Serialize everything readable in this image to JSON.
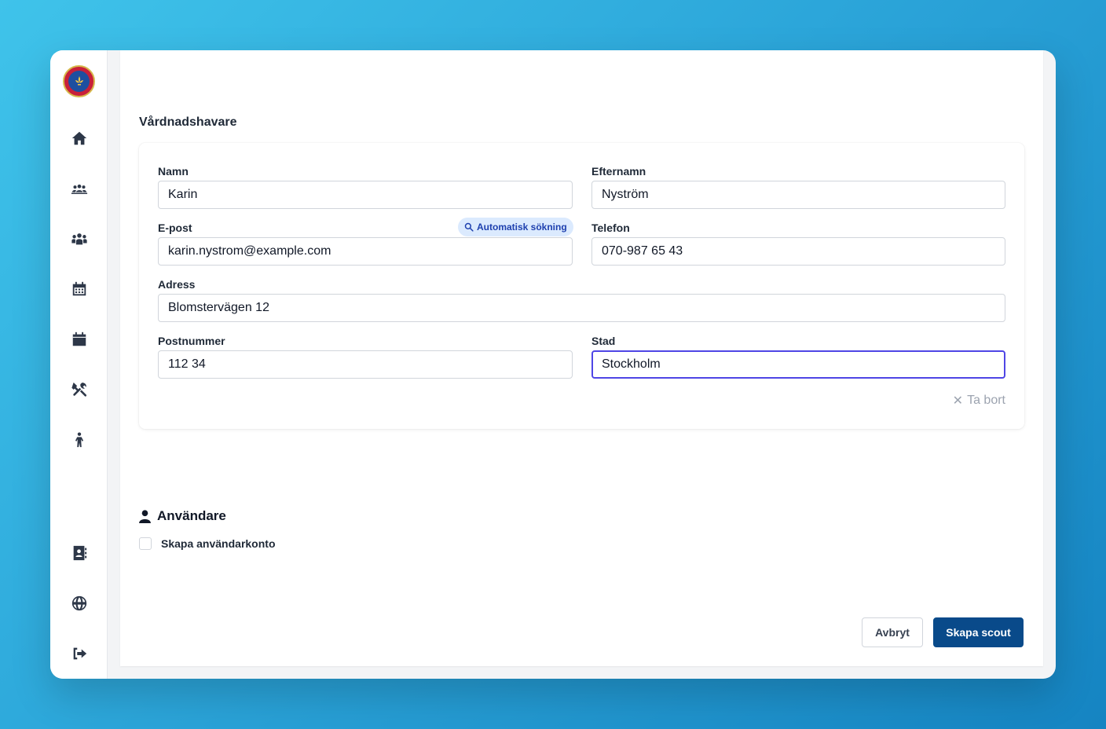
{
  "sidebar": {
    "logo": "scout-logo",
    "items": [
      {
        "icon": "home-icon"
      },
      {
        "icon": "group-icon"
      },
      {
        "icon": "users-icon"
      },
      {
        "icon": "calendar-days-icon"
      },
      {
        "icon": "calendar-icon"
      },
      {
        "icon": "tools-icon"
      },
      {
        "icon": "child-icon"
      }
    ],
    "bottom_items": [
      {
        "icon": "address-book-icon"
      },
      {
        "icon": "globe-icon"
      },
      {
        "icon": "sign-out-icon"
      }
    ]
  },
  "guardian": {
    "section_title": "Vårdnadshavare",
    "first_name_label": "Namn",
    "first_name_value": "Karin",
    "last_name_label": "Efternamn",
    "last_name_value": "Nyström",
    "email_label": "E-post",
    "email_value": "karin.nystrom@example.com",
    "auto_search_label": "Automatisk sökning",
    "phone_label": "Telefon",
    "phone_value": "070-987 65 43",
    "address_label": "Adress",
    "address_value": "Blomstervägen 12",
    "zip_label": "Postnummer",
    "zip_value": "112 34",
    "city_label": "Stad",
    "city_value": "Stockholm",
    "remove_label": "Ta bort"
  },
  "users": {
    "section_title": "Användare",
    "create_account_label": "Skapa användarkonto",
    "create_account_checked": false
  },
  "actions": {
    "cancel_label": "Avbryt",
    "submit_label": "Skapa scout"
  },
  "colors": {
    "primary": "#094a8a",
    "focus": "#4f46e5",
    "badge_bg": "#dbeafe",
    "badge_text": "#1e40af"
  }
}
